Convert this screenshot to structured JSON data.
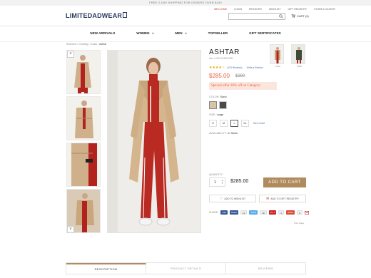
{
  "top_banner": "FREE 2-DAY SHIPPING FOR ORDERS OVER $100",
  "header": {
    "logo": "LIMITEDADWEAR",
    "links": [
      "WELCOME",
      "LOGIN",
      "REGISTER",
      "WISHLIST",
      "GIFT REGISTRY",
      "STORE LOCATOR"
    ],
    "search_placeholder": "",
    "cart_label": "CART (0)"
  },
  "nav": {
    "items": [
      {
        "label": "NEW ARRIVALS",
        "dropdown": false
      },
      {
        "label": "WOMEN",
        "dropdown": true
      },
      {
        "label": "MEN",
        "dropdown": true
      },
      {
        "label": "TOPSELLER",
        "dropdown": false
      },
      {
        "label": "GIFT SERTIFICATES",
        "dropdown": false
      }
    ]
  },
  "breadcrumb": {
    "path": "Womens › Clothing › Coats › ",
    "current": "Ashtar"
  },
  "product": {
    "name": "ASHTAR",
    "sku": "Item # 760131484070B",
    "rating_stars": "★★★★☆",
    "rating": 4,
    "reviews_count": "(123 Reviews)",
    "write_review": "Write a Review",
    "price": "$285.00",
    "old_price": "$290",
    "special_offer": "Special offer 20% off on Category",
    "color_label": "COLOR:",
    "color_value": "Sand",
    "colors": [
      "#d8c4a4",
      "#4a4a4a"
    ],
    "size_label": "SIZE:",
    "size_value": "Large",
    "sizes": [
      "S",
      "M",
      "L",
      "XL"
    ],
    "selected_size": "L",
    "size_chart": "Size Chart",
    "availability_label": "AVAILABILITY:",
    "availability_value": "In Stock",
    "quantity_label": "QUANTITY",
    "quantity": "1",
    "total_price": "$285.00",
    "add_to_cart": "ADD TO CART",
    "add_to_wishlist": "ADD TO WISHLIST",
    "add_to_gift_registry": "ADD TO GIFT REGISTRY",
    "share_label": "SHARE:",
    "share_buttons": [
      "Like",
      "Share",
      "Tweet",
      "Pin it",
      "Share"
    ],
    "share_counts": [
      "12",
      "18",
      "4",
      "0"
    ],
    "print_label": "Print Page"
  },
  "related": [
    {
      "caption": "+Pinc"
    },
    {
      "caption": "+Pinc"
    }
  ],
  "tabs": [
    {
      "label": "DESCRIPTION",
      "active": true
    },
    {
      "label": "PRODUCT DETAILS",
      "active": false
    },
    {
      "label": "REVIEWS",
      "active": false
    }
  ]
}
